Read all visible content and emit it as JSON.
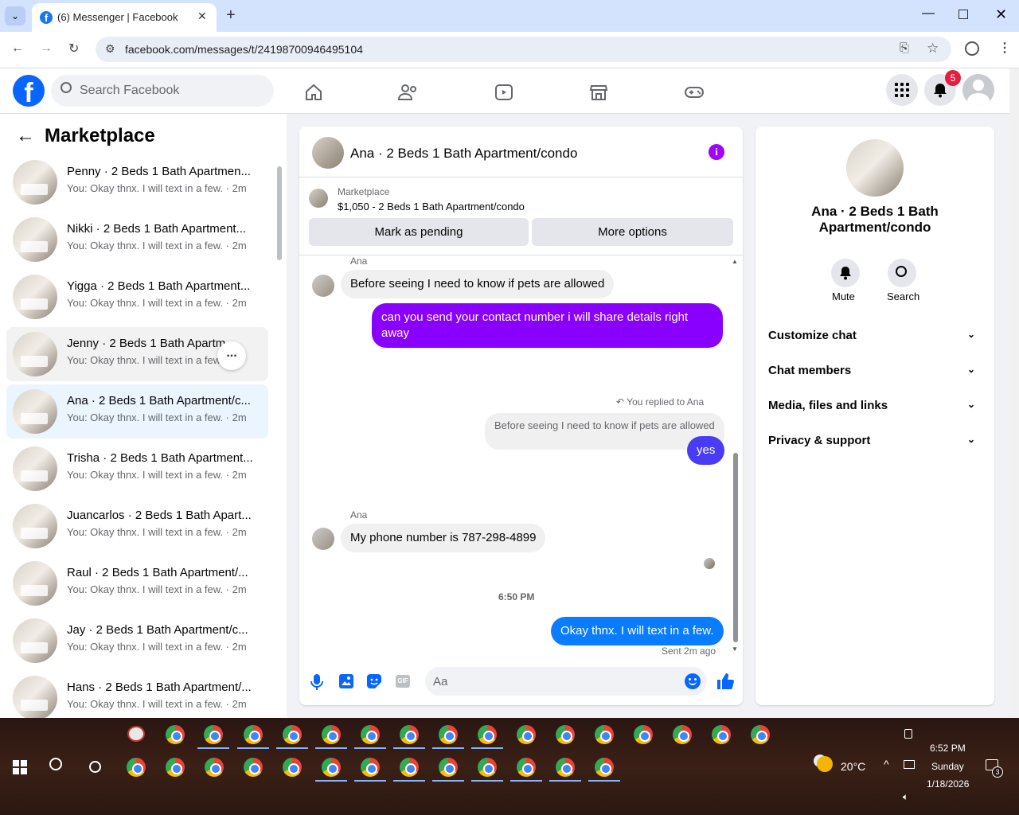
{
  "browser": {
    "tab_title": "(6) Messenger | Facebook",
    "url": "facebook.com/messages/t/24198700946495104"
  },
  "header": {
    "search_placeholder": "Search Facebook",
    "notification_count": "5"
  },
  "sidebar": {
    "title": "Marketplace",
    "conversations": [
      {
        "name": "Penny · 2 Beds 1 Bath Apartmen...",
        "preview": "You: Okay thnx. I will text in a few. · 2m"
      },
      {
        "name": "Nikki · 2 Beds 1 Bath Apartment...",
        "preview": "You: Okay thnx. I will text in a few. · 2m"
      },
      {
        "name": "Yigga · 2 Beds 1 Bath Apartment...",
        "preview": "You: Okay thnx. I will text in a few. · 2m"
      },
      {
        "name": "Jenny · 2 Beds 1 Bath Apartm...",
        "preview": "You: Okay thnx. I will text in a few..."
      },
      {
        "name": "Ana · 2 Beds 1 Bath Apartment/c...",
        "preview": "You: Okay thnx. I will text in a few. · 2m"
      },
      {
        "name": "Trisha · 2 Beds 1 Bath Apartment...",
        "preview": "You: Okay thnx. I will text in a few. · 2m"
      },
      {
        "name": "Juancarlos · 2 Beds 1 Bath Apart...",
        "preview": "You: Okay thnx. I will text in a few. · 2m"
      },
      {
        "name": "Raul · 2 Beds 1 Bath Apartment/...",
        "preview": "You: Okay thnx. I will text in a few. · 2m"
      },
      {
        "name": "Jay · 2 Beds 1 Bath Apartment/c...",
        "preview": "You: Okay thnx. I will text in a few. · 2m"
      },
      {
        "name": "Hans · 2 Beds 1 Bath Apartment/...",
        "preview": "You: Okay thnx. I will text in a few. · 2m"
      }
    ],
    "more_label": "..."
  },
  "chat": {
    "title": "Ana · 2 Beds 1 Bath Apartment/condo",
    "listing_source": "Marketplace",
    "listing": "$1,050 - 2 Beds 1 Bath Apartment/condo",
    "mark_pending": "Mark as pending",
    "more_options": "More options",
    "sender_label_1": "Ana",
    "msg_1": "Before seeing I need to know if pets are allowed",
    "msg_2": "can you send your contact number i will share details right away",
    "replied_label": "You replied to Ana",
    "quoted": "Before seeing I need to know if pets are allowed",
    "msg_3": "yes",
    "sender_label_2": "Ana",
    "msg_4": "My phone number is 787-298-4899",
    "timestamp": "6:50 PM",
    "msg_5": "Okay thnx. I will text in a few.",
    "sent_status": "Sent 2m ago",
    "composer_placeholder": "Aa"
  },
  "details": {
    "title": "Ana · 2 Beds 1 Bath Apartment/condo",
    "mute_label": "Mute",
    "search_label": "Search",
    "sections": [
      "Customize chat",
      "Chat members",
      "Media, files and links",
      "Privacy & support"
    ]
  },
  "taskbar": {
    "weather": "20°C",
    "time": "6:52 PM",
    "day": "Sunday",
    "date": "1/18/2026",
    "notif_count": "3"
  }
}
